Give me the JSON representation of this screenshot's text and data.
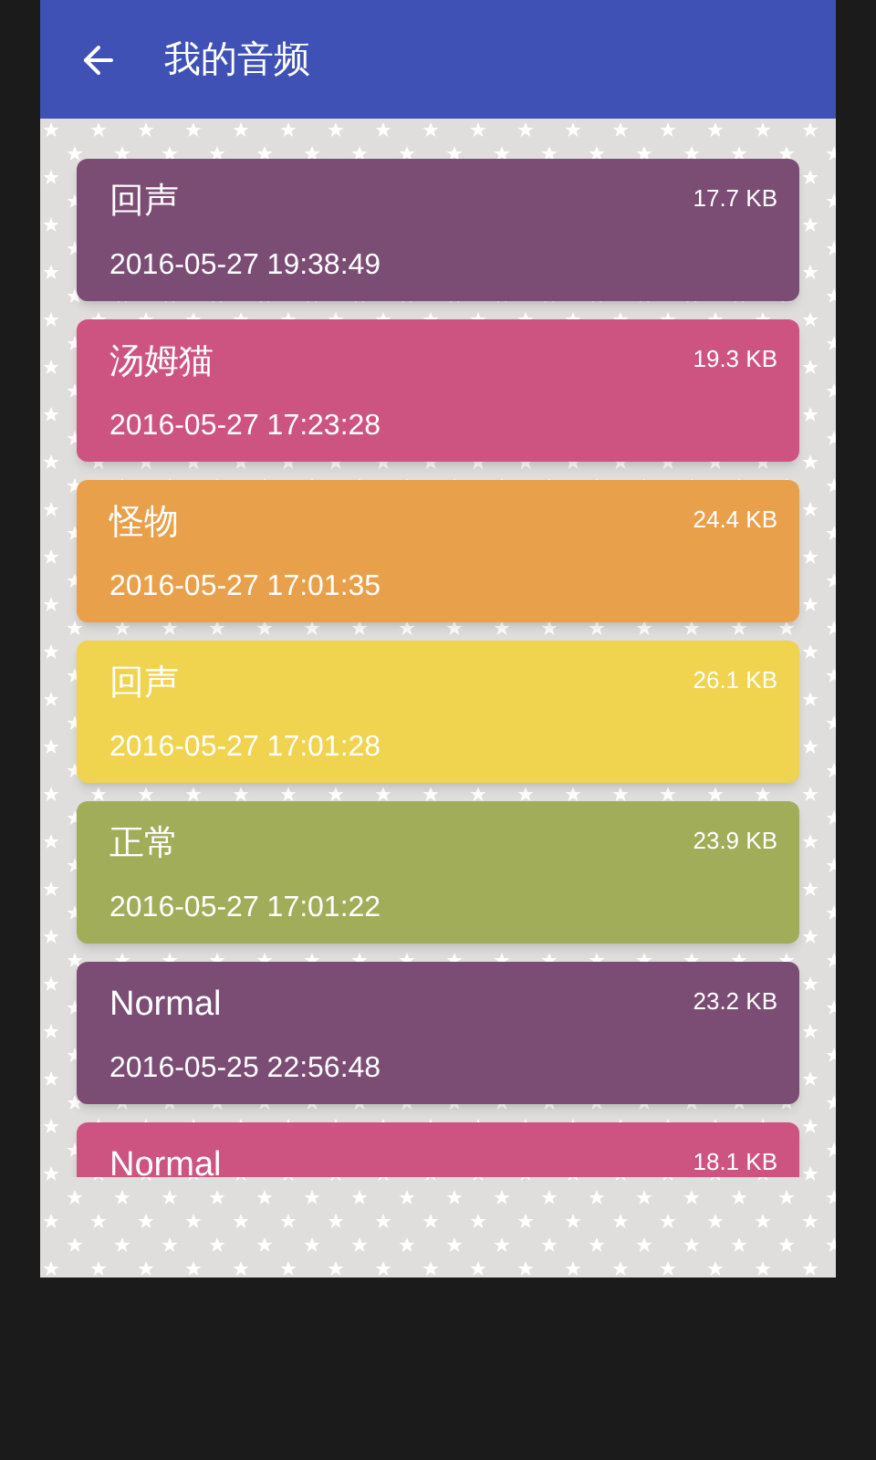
{
  "app_bar": {
    "title": "我的音频"
  },
  "recordings": [
    {
      "title": "回声",
      "date": "2016-05-27 19:38:49",
      "size": "17.7 KB",
      "color": "#7b4c74"
    },
    {
      "title": "汤姆猫",
      "date": "2016-05-27 17:23:28",
      "size": "19.3 KB",
      "color": "#cd5480"
    },
    {
      "title": "怪物",
      "date": "2016-05-27 17:01:35",
      "size": "24.4 KB",
      "color": "#e9a04b"
    },
    {
      "title": "回声",
      "date": "2016-05-27 17:01:28",
      "size": "26.1 KB",
      "color": "#f0d34e"
    },
    {
      "title": "正常",
      "date": "2016-05-27 17:01:22",
      "size": "23.9 KB",
      "color": "#a2ad5a"
    },
    {
      "title": "Normal",
      "date": "2016-05-25 22:56:48",
      "size": "23.2 KB",
      "color": "#7b4c74"
    },
    {
      "title": "Normal",
      "size": "18.1 KB",
      "color": "#cd5480"
    }
  ]
}
